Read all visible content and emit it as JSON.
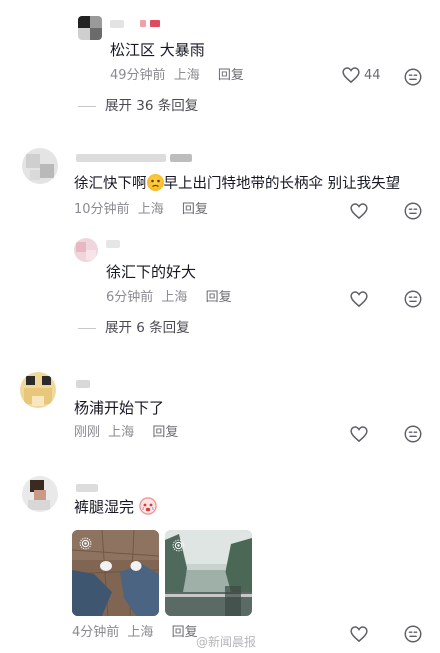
{
  "comments": [
    {
      "text": "松江区 大暴雨",
      "meta": {
        "time": "49分钟前",
        "location": "上海",
        "reply_label": "回复"
      },
      "like_count": "44",
      "expand_label": "展开 36 条回复"
    },
    {
      "text_before": "徐汇快下啊",
      "emoji": "sad-face-emoji",
      "text_after": "早上出门特地带的长柄伞 别让我失望",
      "meta": {
        "time": "10分钟前",
        "location": "上海",
        "reply_label": "回复"
      },
      "reply": {
        "text": "徐汇下的好大",
        "meta": {
          "time": "6分钟前",
          "location": "上海",
          "reply_label": "回复"
        }
      },
      "expand_label": "展开 6 条回复"
    },
    {
      "text": "杨浦开始下了",
      "meta": {
        "time": "刚刚",
        "location": "上海",
        "reply_label": "回复"
      }
    },
    {
      "text": "裤腿湿完",
      "emoji": "crying-face-emoji",
      "images": [
        "wet-pants-photo",
        "rainy-river-photo"
      ],
      "meta": {
        "time": "4分钟前",
        "location": "上海",
        "reply_label": "回复"
      }
    }
  ],
  "icons": {
    "like": "heart-outline-icon",
    "more": "emoji-reaction-icon",
    "live_photo": "live-photo-icon"
  },
  "watermark": "@新闻晨报",
  "colors": {
    "text": "#161823",
    "meta": "#8a8b91",
    "background": "#ffffff"
  }
}
